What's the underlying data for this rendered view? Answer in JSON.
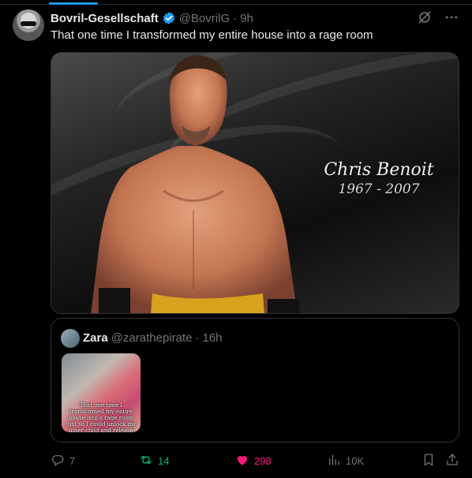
{
  "author": {
    "name": "Bovril-Gesellschaft",
    "handle": "@BovrilG",
    "separator": "·",
    "time": "9h",
    "verified_icon": "verified-badge-icon"
  },
  "tweet": {
    "text": "That one time I transformed my entire house into a rage room"
  },
  "media": {
    "memorial_name": "Chris Benoit",
    "memorial_years": "1967 - 2007"
  },
  "quote": {
    "name": "Zara",
    "handle": "@zarathepirate",
    "separator": "·",
    "time": "16h",
    "thumb_caption": "That one time I transformed my entire house into a rage room just so I could unlock my inner child and release"
  },
  "actions": {
    "replies": "7",
    "reposts": "14",
    "likes": "298",
    "views": "10K"
  },
  "colors": {
    "accent": "#1d9bf0",
    "repost": "#00ba7c",
    "like": "#f91880",
    "muted": "#71767b"
  }
}
